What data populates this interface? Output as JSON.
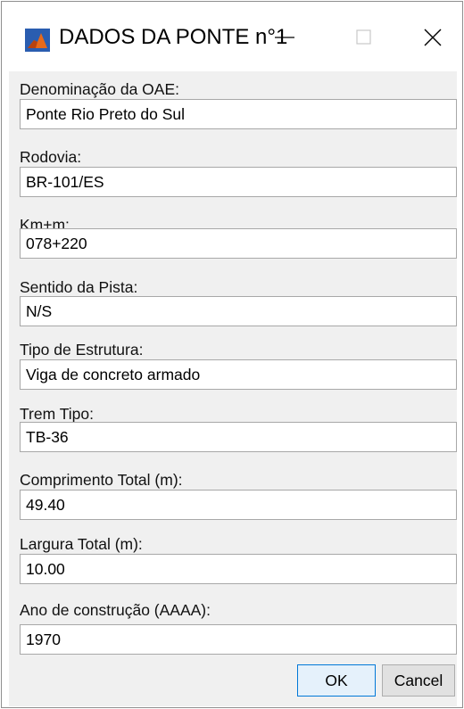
{
  "window": {
    "title": "DADOS DA PONTE n°1",
    "icon": "matlab-icon"
  },
  "fields": [
    {
      "label": "Denominação da OAE:",
      "value": "Ponte Rio Preto do Sul"
    },
    {
      "label": "Rodovia:",
      "value": "BR-101/ES"
    },
    {
      "label": "Km+m:",
      "value": "078+220"
    },
    {
      "label": "Sentido da Pista:",
      "value": "N/S"
    },
    {
      "label": "Tipo de Estrutura:",
      "value": "Viga de concreto armado"
    },
    {
      "label": "Trem Tipo:",
      "value": "TB-36"
    },
    {
      "label": "Comprimento Total (m):",
      "value": "49.40"
    },
    {
      "label": "Largura Total (m):",
      "value": "10.00"
    },
    {
      "label": "Ano de construção (AAAA):",
      "value": "1970"
    }
  ],
  "buttons": {
    "ok": "OK",
    "cancel": "Cancel"
  },
  "colors": {
    "content_bg": "#f0f0f0",
    "ok_border": "#0078d7",
    "icon_orange": "#e86a1a",
    "icon_blue": "#2a5db0"
  }
}
